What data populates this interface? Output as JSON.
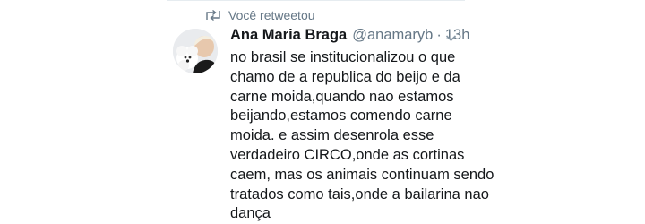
{
  "retweet": {
    "label": "Você retweetou",
    "icon": "retweet-icon"
  },
  "tweet": {
    "author": {
      "name": "Ana Maria Braga",
      "handle": "@anamaryb",
      "avatar": "avatar-photo"
    },
    "separator": "·",
    "time": "13h",
    "menu_icon": "chevron-down-icon",
    "lines": [
      "no brasil se institucionalizou o que",
      "chamo de a republica do beijo e da",
      "carne moida,quando nao estamos",
      "beijando,estamos comendo carne",
      "moida. e assim desenrola esse",
      "verdadeiro CIRCO,onde as cortinas",
      "caem, mas os animais continuam sendo",
      "tratados como tais,onde a bailarina nao",
      "dança"
    ]
  },
  "colors": {
    "text": "#14171a",
    "secondary": "#657786",
    "divider": "#e6ecf0",
    "background": "#ffffff"
  }
}
